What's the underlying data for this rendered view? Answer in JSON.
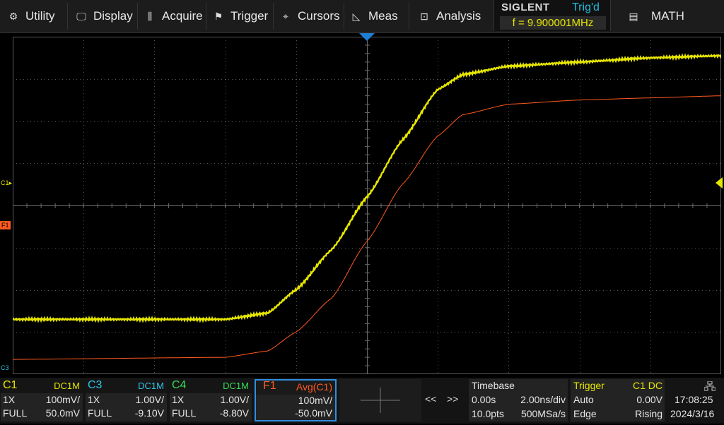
{
  "menu": {
    "items": [
      {
        "label": "Utility",
        "icon": "gear-icon",
        "glyph": "⚙"
      },
      {
        "label": "Display",
        "icon": "monitor-icon",
        "glyph": "🖵"
      },
      {
        "label": "Acquire",
        "icon": "acquire-icon",
        "glyph": "⫼"
      },
      {
        "label": "Trigger",
        "icon": "flag-icon",
        "glyph": "⚑"
      },
      {
        "label": "Cursors",
        "icon": "crosshair-icon",
        "glyph": "⌖"
      },
      {
        "label": "Meas",
        "icon": "ruler-icon",
        "glyph": "◺"
      },
      {
        "label": "Analysis",
        "icon": "analysis-icon",
        "glyph": "⊡"
      }
    ],
    "math_label": "MATH",
    "math_glyph": "▤"
  },
  "status": {
    "brand": "SIGLENT",
    "trig_state": "Trig'd",
    "frequency": "f = 9.900001MHz"
  },
  "markers": {
    "c1": "C1",
    "f1": "F1",
    "c3": "C3"
  },
  "colors": {
    "c1": "#e6e600",
    "c3": "#2ec4e6",
    "c4": "#33dd55",
    "f1": "#ff5a1f",
    "trigger": "#1fa0ff",
    "grid": "#5a5a5a"
  },
  "channels": {
    "c1": {
      "name": "C1",
      "coupling": "DC1M",
      "probe": "1X",
      "scale": "100mV/",
      "bw": "FULL",
      "offset": "50.0mV"
    },
    "c3": {
      "name": "C3",
      "coupling": "DC1M",
      "probe": "1X",
      "scale": "1.00V/",
      "bw": "FULL",
      "offset": "-9.10V"
    },
    "c4": {
      "name": "C4",
      "coupling": "DC1M",
      "probe": "1X",
      "scale": "1.00V/",
      "bw": "FULL",
      "offset": "-8.80V"
    },
    "f1": {
      "name": "F1",
      "func": "Avg(C1)",
      "scale": "100mV/",
      "offset": "-50.0mV"
    }
  },
  "nav": {
    "prev": "<<",
    "next": ">>"
  },
  "timebase": {
    "label": "Timebase",
    "delay": "0.00s",
    "scale": "2.00ns/div",
    "points": "10.0pts",
    "rate": "500MSa/s"
  },
  "trigger": {
    "label": "Trigger",
    "source": "C1 DC",
    "mode": "Auto",
    "level": "0.00V",
    "type": "Edge",
    "slope": "Rising"
  },
  "clock": {
    "time": "17:08:25",
    "date": "2024/3/16"
  },
  "chart_data": {
    "type": "line",
    "x_unit": "ns",
    "xlim": [
      -10,
      10
    ],
    "series": [
      {
        "name": "C1",
        "values": [
          [
            -10,
            -2.7
          ],
          [
            -4,
            -2.7
          ],
          [
            -2.8,
            -2.55
          ],
          [
            -2,
            -2.0
          ],
          [
            -1,
            -1.05
          ],
          [
            0,
            0.2
          ],
          [
            1,
            1.55
          ],
          [
            2,
            2.75
          ],
          [
            2.7,
            3.1
          ],
          [
            4,
            3.3
          ],
          [
            6,
            3.4
          ],
          [
            8,
            3.5
          ],
          [
            10,
            3.55
          ]
        ]
      },
      {
        "name": "F1",
        "values": [
          [
            -10,
            -3.65
          ],
          [
            -4,
            -3.6
          ],
          [
            -2.8,
            -3.45
          ],
          [
            -2,
            -3.0
          ],
          [
            -1,
            -2.2
          ],
          [
            0,
            -0.85
          ],
          [
            1,
            0.5
          ],
          [
            2,
            1.65
          ],
          [
            2.7,
            2.15
          ],
          [
            4,
            2.4
          ],
          [
            6,
            2.5
          ],
          [
            8,
            2.55
          ],
          [
            10,
            2.6
          ]
        ]
      }
    ]
  }
}
